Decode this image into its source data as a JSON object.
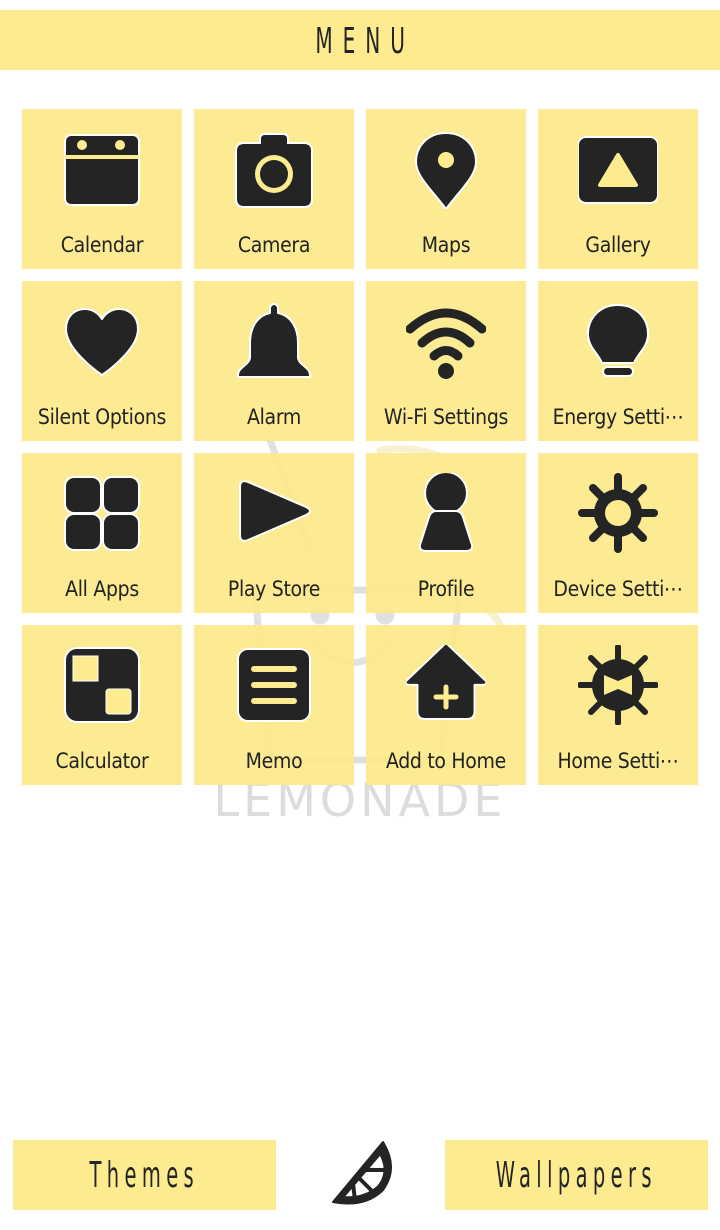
{
  "header": {
    "title": "MENU"
  },
  "watermark": {
    "text": "LEMONADE"
  },
  "colors": {
    "tile_bg": "#fdeb8f",
    "icon": "#242424",
    "text": "#222222",
    "watermark": "#d9d9d9"
  },
  "grid": {
    "items": [
      {
        "label": "Calendar",
        "icon": "calendar-icon"
      },
      {
        "label": "Camera",
        "icon": "camera-icon"
      },
      {
        "label": "Maps",
        "icon": "map-pin-icon"
      },
      {
        "label": "Gallery",
        "icon": "gallery-icon"
      },
      {
        "label": "Silent Options",
        "icon": "heart-icon"
      },
      {
        "label": "Alarm",
        "icon": "bell-icon"
      },
      {
        "label": "Wi-Fi Settings",
        "icon": "wifi-icon"
      },
      {
        "label": "Energy Setti⋯",
        "icon": "lightbulb-icon"
      },
      {
        "label": "All Apps",
        "icon": "grid-icon"
      },
      {
        "label": "Play Store",
        "icon": "play-icon"
      },
      {
        "label": "Profile",
        "icon": "person-icon"
      },
      {
        "label": "Device Setti⋯",
        "icon": "gear-icon"
      },
      {
        "label": "Calculator",
        "icon": "calculator-icon"
      },
      {
        "label": "Memo",
        "icon": "memo-icon"
      },
      {
        "label": "Add to Home",
        "icon": "add-home-icon"
      },
      {
        "label": "Home Setti⋯",
        "icon": "home-settings-icon"
      }
    ]
  },
  "footer": {
    "themes_label": "Themes",
    "wallpapers_label": "Wallpapers",
    "center_icon": "lemon-slice-icon"
  }
}
